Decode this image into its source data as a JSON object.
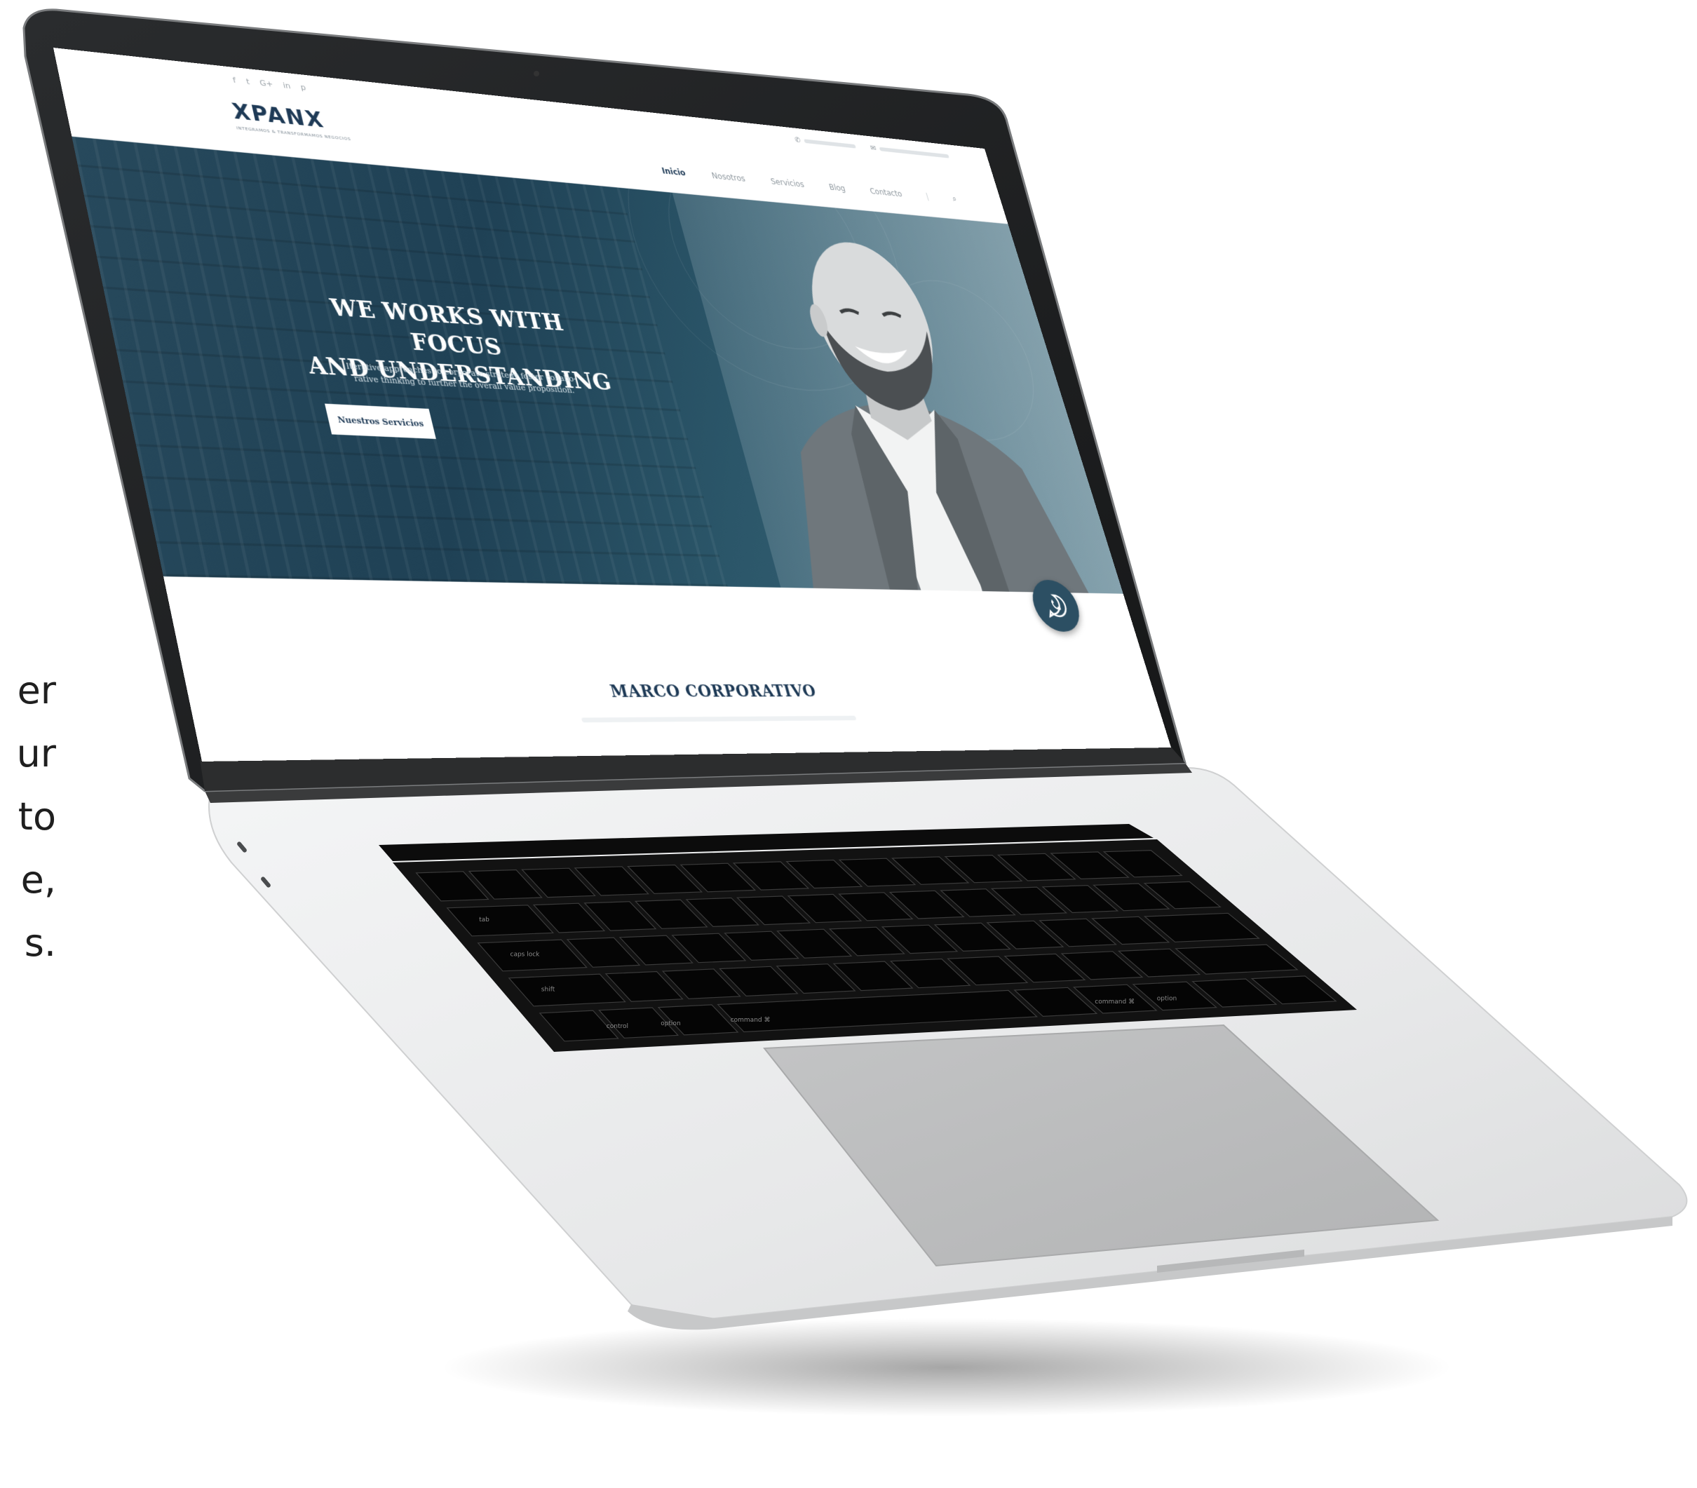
{
  "side_text": {
    "lines": [
      "er",
      "ur",
      "to",
      "e,",
      "s."
    ]
  },
  "topbar": {
    "social_icons": [
      "facebook-icon",
      "twitter-icon",
      "google-plus-icon",
      "linkedin-icon",
      "pinterest-icon"
    ],
    "social_glyphs": [
      "f",
      "t",
      "G+",
      "in",
      "p"
    ]
  },
  "site": {
    "logo": {
      "name": "XPANX",
      "tagline": "INTEGRAMOS & TRANSFORMAMOS NEGOCIOS"
    },
    "nav": [
      {
        "label": "Inicio",
        "active": true
      },
      {
        "label": "Nosotros",
        "active": false
      },
      {
        "label": "Servicios",
        "active": false
      },
      {
        "label": "Blog",
        "active": false
      },
      {
        "label": "Contacto",
        "active": false
      }
    ],
    "hero": {
      "headline_1": "WE WORKS WITH FOCUS",
      "headline_2": "AND UNDERSTANDING",
      "sub_1": "Iterative approaches to corporate strategy foster collabo-",
      "sub_2": "rative thinking to further the overall value proposition.",
      "cta": "Nuestros Servicios"
    },
    "section": {
      "title": "MARCO CORPORATIVO"
    }
  },
  "keyboard": {
    "labels": [
      "tab",
      "caps lock",
      "shift",
      "control",
      "option",
      "command ⌘",
      "command ⌘",
      "option"
    ]
  },
  "colors": {
    "brand": "#1e3a56",
    "hero_bg": "#27495c",
    "whatsapp": "#2c4f63",
    "keyboard": "#111111",
    "body_silver": "#e6e7e8"
  }
}
